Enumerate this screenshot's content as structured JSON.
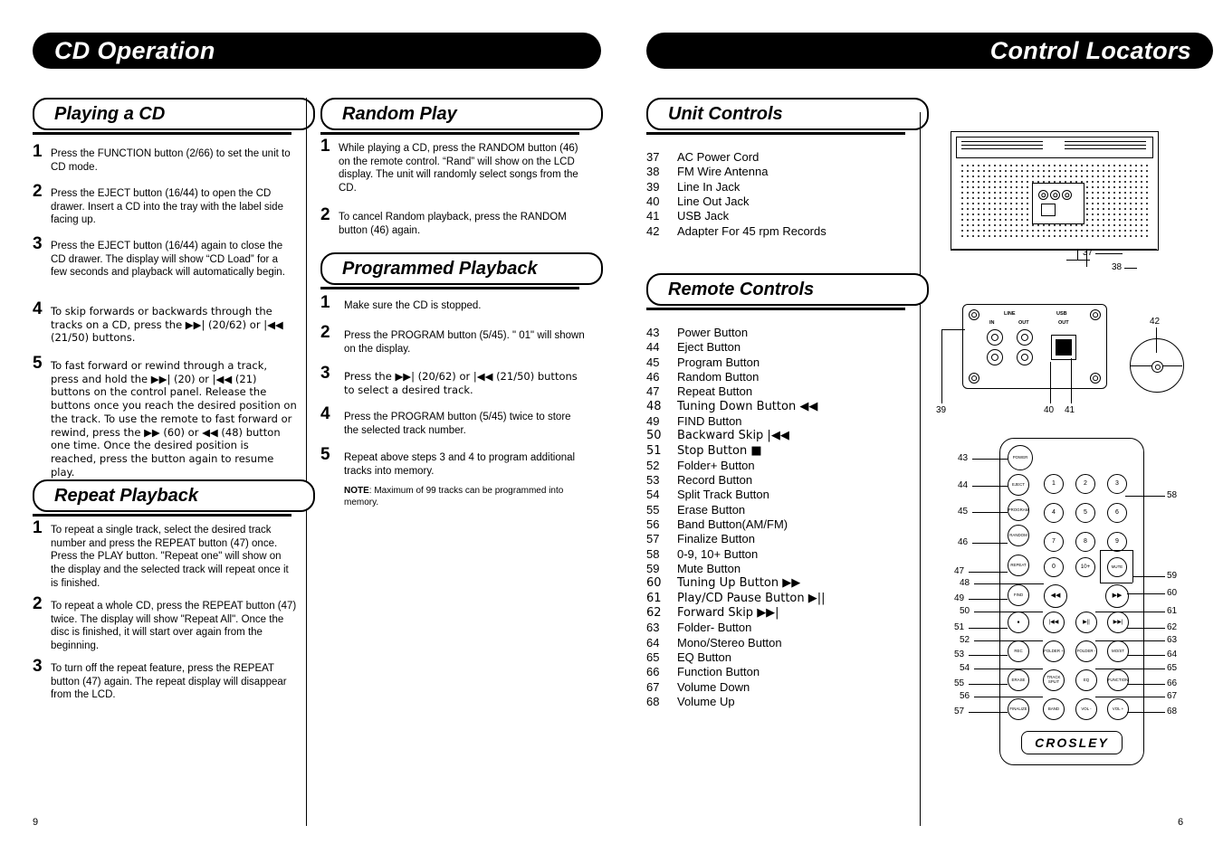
{
  "left_page": {
    "banner_title": "CD Operation",
    "page_number": "9",
    "sections": [
      {
        "title": "Playing a CD",
        "steps": [
          {
            "num": "1",
            "text": "Press the FUNCTION button (2/66) to set the unit to CD mode."
          },
          {
            "num": "2",
            "text": "Press the EJECT button (16/44) to open the CD drawer. Insert a CD into the tray with the label side facing up."
          },
          {
            "num": "3",
            "text": "Press the EJECT button (16/44) again to close the CD drawer. The display will show “CD Load” for a few seconds and playback will automatically begin."
          },
          {
            "num": "4",
            "text": "To skip forwards or backwards through the tracks on a CD, press the ▶▶| (20/62) or |◀◀ (21/50) buttons."
          },
          {
            "num": "5",
            "text": "To fast forward or rewind through a track, press and hold the ▶▶| (20) or |◀◀ (21) buttons on the control panel. Release the buttons once you reach the desired position on the track. To use the remote to fast forward or rewind, press the ▶▶ (60) or ◀◀ (48) button one time. Once the desired position is reached, press the button again to resume play."
          }
        ]
      },
      {
        "title": "Repeat Playback",
        "steps": [
          {
            "num": "1",
            "text": "To repeat a single track, select the desired track number and press the REPEAT button (47) once. Press the PLAY button. \"Repeat one\" will show on the display and the selected track will repeat once it is finished."
          },
          {
            "num": "2",
            "text": "To repeat a whole CD, press the REPEAT button (47) twice. The display will show \"Repeat All\". Once the disc is finished, it will start over again from the beginning."
          },
          {
            "num": "3",
            "text": "To turn off the repeat feature, press the REPEAT button (47) again. The repeat display will disappear from the LCD."
          }
        ]
      },
      {
        "title": "Random Play",
        "steps": [
          {
            "num": "1",
            "text": "While playing a CD, press the RANDOM button (46) on the remote control. “Rand” will show on the LCD display. The unit will randomly select songs from the CD."
          },
          {
            "num": "2",
            "text": "To cancel Random playback, press the RANDOM button (46) again."
          }
        ]
      },
      {
        "title": "Programmed Playback",
        "steps": [
          {
            "num": "1",
            "text": "Make sure the CD is stopped."
          },
          {
            "num": "2",
            "text": "Press the PROGRAM button (5/45). \" 01\" will shown on the display."
          },
          {
            "num": "3",
            "text": "Press the ▶▶| (20/62) or  |◀◀ (21/50) buttons to select a desired track."
          },
          {
            "num": "4",
            "text": "Press the PROGRAM button (5/45) twice to store the selected track number."
          },
          {
            "num": "5",
            "text": "Repeat above steps 3 and 4 to program additional tracks into memory."
          }
        ],
        "note_label": "NOTE",
        "note_text": ": Maximum of 99 tracks can be programmed into memory."
      }
    ]
  },
  "right_page": {
    "banner_title": "Control Locators",
    "page_number": "6",
    "unit_controls": {
      "title": "Unit Controls",
      "items": [
        {
          "num": "37",
          "label": "AC Power Cord"
        },
        {
          "num": "38",
          "label": "FM Wire Antenna"
        },
        {
          "num": "39",
          "label": "Line In Jack"
        },
        {
          "num": "40",
          "label": "Line Out Jack"
        },
        {
          "num": "41",
          "label": "USB Jack"
        },
        {
          "num": "42",
          "label": "Adapter For 45 rpm Records"
        }
      ]
    },
    "remote_controls": {
      "title": "Remote Controls",
      "items": [
        {
          "num": "43",
          "label": "Power Button"
        },
        {
          "num": "44",
          "label": "Eject Button"
        },
        {
          "num": "45",
          "label": "Program Button"
        },
        {
          "num": "46",
          "label": "Random Button"
        },
        {
          "num": "47",
          "label": "Repeat Button"
        },
        {
          "num": "48",
          "label": "Tuning Down Button ◀◀"
        },
        {
          "num": "49",
          "label": "FIND Button"
        },
        {
          "num": "50",
          "label": "Backward Skip |◀◀"
        },
        {
          "num": "51",
          "label": "Stop Button ■"
        },
        {
          "num": "52",
          "label": "Folder+ Button"
        },
        {
          "num": "53",
          "label": "Record Button"
        },
        {
          "num": "54",
          "label": "Split Track Button"
        },
        {
          "num": "55",
          "label": "Erase Button"
        },
        {
          "num": "56",
          "label": "Band Button(AM/FM)"
        },
        {
          "num": "57",
          "label": "Finalize Button"
        },
        {
          "num": "58",
          "label": "0-9, 10+ Button"
        },
        {
          "num": "59",
          "label": "Mute Button"
        },
        {
          "num": "60",
          "label": "Tuning Up Button ▶▶"
        },
        {
          "num": "61",
          "label": "Play/CD Pause Button ▶||"
        },
        {
          "num": "62",
          "label": "Forward Skip ▶▶|"
        },
        {
          "num": "63",
          "label": "Folder- Button"
        },
        {
          "num": "64",
          "label": "Mono/Stereo Button"
        },
        {
          "num": "65",
          "label": "EQ Button"
        },
        {
          "num": "66",
          "label": "Function Button"
        },
        {
          "num": "67",
          "label": "Volume Down"
        },
        {
          "num": "68",
          "label": "Volume Up"
        }
      ]
    },
    "diagram": {
      "unit_callouts": [
        {
          "num": "37"
        },
        {
          "num": "38"
        }
      ],
      "jack_callouts": [
        {
          "num": "39"
        },
        {
          "num": "40"
        },
        {
          "num": "41"
        },
        {
          "num": "42"
        }
      ],
      "jack_labels": [
        "LINE",
        "IN",
        "OUT",
        "USB",
        "OUT"
      ],
      "remote_left_callouts": [
        "43",
        "44",
        "45",
        "46",
        "47",
        "48",
        "49",
        "50",
        "51",
        "52",
        "53",
        "54",
        "55",
        "56",
        "57"
      ],
      "remote_right_callouts": [
        "58",
        "59",
        "60",
        "61",
        "62",
        "63",
        "64",
        "65",
        "66",
        "67",
        "68"
      ],
      "remote_brand": "CROSLEY",
      "remote_buttons": [
        {
          "name": "power",
          "label": "POWER"
        },
        {
          "name": "eject",
          "label": "EJECT"
        },
        {
          "name": "program",
          "label": "PROGRAM"
        },
        {
          "name": "random",
          "label": "RANDOM"
        },
        {
          "name": "repeat",
          "label": "REPEAT"
        },
        {
          "name": "find",
          "label": "FIND"
        },
        {
          "name": "stop",
          "label": "■"
        },
        {
          "name": "rec",
          "label": "REC"
        },
        {
          "name": "erase",
          "label": "ERASE"
        },
        {
          "name": "finalize",
          "label": "FINALIZE"
        },
        {
          "name": "digit-1",
          "label": "1"
        },
        {
          "name": "digit-2",
          "label": "2"
        },
        {
          "name": "digit-3",
          "label": "3"
        },
        {
          "name": "digit-4",
          "label": "4"
        },
        {
          "name": "digit-5",
          "label": "5"
        },
        {
          "name": "digit-6",
          "label": "6"
        },
        {
          "name": "digit-7",
          "label": "7"
        },
        {
          "name": "digit-8",
          "label": "8"
        },
        {
          "name": "digit-9",
          "label": "9"
        },
        {
          "name": "digit-0",
          "label": "0"
        },
        {
          "name": "digit-10plus",
          "label": "10+"
        },
        {
          "name": "mute",
          "label": "MUTE"
        },
        {
          "name": "tuning-down",
          "label": "◀◀"
        },
        {
          "name": "tuning-up",
          "label": "▶▶"
        },
        {
          "name": "backward-skip",
          "label": "|◀◀"
        },
        {
          "name": "play-pause",
          "label": "▶||"
        },
        {
          "name": "forward-skip",
          "label": "▶▶|"
        },
        {
          "name": "folder-plus",
          "label": "FOLDER +"
        },
        {
          "name": "folder-minus",
          "label": "FOLDER -"
        },
        {
          "name": "mono-stereo",
          "label": "MO/ST"
        },
        {
          "name": "track-split",
          "label": "TRACK SPLIT"
        },
        {
          "name": "eq",
          "label": "EQ"
        },
        {
          "name": "function",
          "label": "FUNCTION"
        },
        {
          "name": "band",
          "label": "BAND"
        },
        {
          "name": "volume-down",
          "label": "VOL -"
        },
        {
          "name": "volume-up",
          "label": "VOL +"
        }
      ]
    }
  }
}
